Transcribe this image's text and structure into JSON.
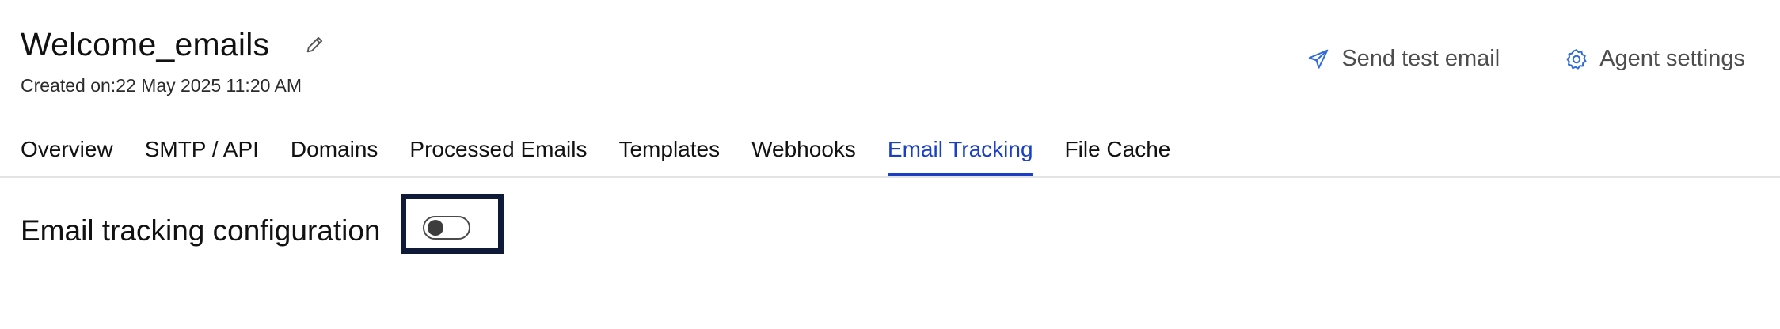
{
  "header": {
    "title": "Welcome_emails",
    "created_on": "Created on:22 May 2025 11:20 AM",
    "actions": {
      "send_test_email": "Send test email",
      "agent_settings": "Agent settings"
    },
    "icons": {
      "edit": "pencil-icon",
      "send": "paper-plane-icon",
      "settings": "gear-icon"
    }
  },
  "tabs": [
    {
      "label": "Overview",
      "active": false
    },
    {
      "label": "SMTP / API",
      "active": false
    },
    {
      "label": "Domains",
      "active": false
    },
    {
      "label": "Processed Emails",
      "active": false
    },
    {
      "label": "Templates",
      "active": false
    },
    {
      "label": "Webhooks",
      "active": false
    },
    {
      "label": "Email Tracking",
      "active": true
    },
    {
      "label": "File Cache",
      "active": false
    }
  ],
  "email_tracking": {
    "section_title": "Email tracking configuration",
    "enabled": false
  },
  "colors": {
    "accent": "#1a3fc7",
    "icon_blue": "#2f6ad9",
    "highlight_frame": "#0e1a38"
  }
}
